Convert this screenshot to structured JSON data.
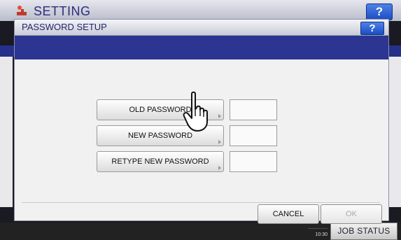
{
  "app": {
    "title": "SETTING",
    "help_label": "?"
  },
  "dialog": {
    "title": "PASSWORD SETUP",
    "help_label": "?",
    "buttons": [
      {
        "label": "OLD PASSWORD"
      },
      {
        "label": "NEW PASSWORD"
      },
      {
        "label": "RETYPE NEW PASSWORD"
      }
    ],
    "fields": [
      {
        "value": ""
      },
      {
        "value": ""
      },
      {
        "value": ""
      }
    ],
    "cancel_label": "CANCEL",
    "ok_label": "OK"
  },
  "footer": {
    "time": "10:30",
    "job_status_label": "JOB STATUS"
  },
  "colors": {
    "accent_blue": "#2c3591",
    "help_button": "#2a5bd7",
    "disabled_text": "#a8a8a8"
  }
}
